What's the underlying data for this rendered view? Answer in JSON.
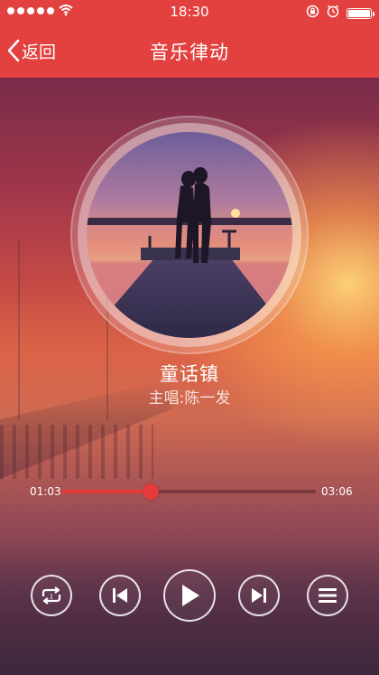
{
  "status_bar": {
    "time": "18:30",
    "signal_bars": 5,
    "icons": [
      "signal-dots-icon",
      "wifi-icon",
      "rotation-lock-icon",
      "alarm-icon",
      "battery-icon"
    ]
  },
  "nav": {
    "back_label": "返回",
    "title": "音乐律动"
  },
  "song": {
    "title": "童话镇",
    "artist": "主唱:陈一发"
  },
  "progress": {
    "current": "01:03",
    "total": "03:06",
    "fraction": 0.35
  },
  "controls": {
    "icons": [
      "repeat-icon",
      "previous-icon",
      "play-icon",
      "next-icon",
      "playlist-icon"
    ]
  },
  "colors": {
    "accent": "#e2413f",
    "progress": "#e53b3b"
  }
}
